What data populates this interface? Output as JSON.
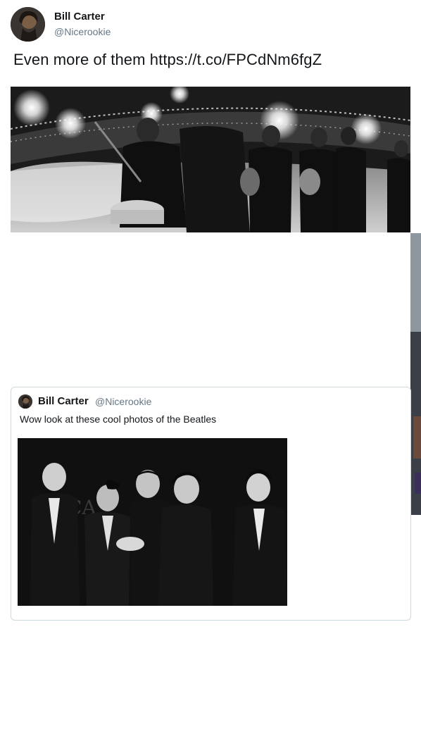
{
  "tweet": {
    "author": {
      "name": "Bill Carter",
      "handle": "@Nicerookie",
      "avatar_icon": "profile-photo-avatar"
    },
    "text": "Even more of them https://t.co/FPCdNm6fgZ",
    "media_icon": "photo-beatles-stage"
  },
  "quoted_tweet": {
    "author": {
      "name": "Bill Carter",
      "handle": "@Nicerookie",
      "avatar_icon": "profile-photo-avatar"
    },
    "text": "Wow look at these cool photos of the Beatles",
    "media_icon": "photo-beatles-tuxedos"
  },
  "colors": {
    "text_primary": "#14171a",
    "text_secondary": "#657786",
    "card_border": "#cfd9de"
  }
}
